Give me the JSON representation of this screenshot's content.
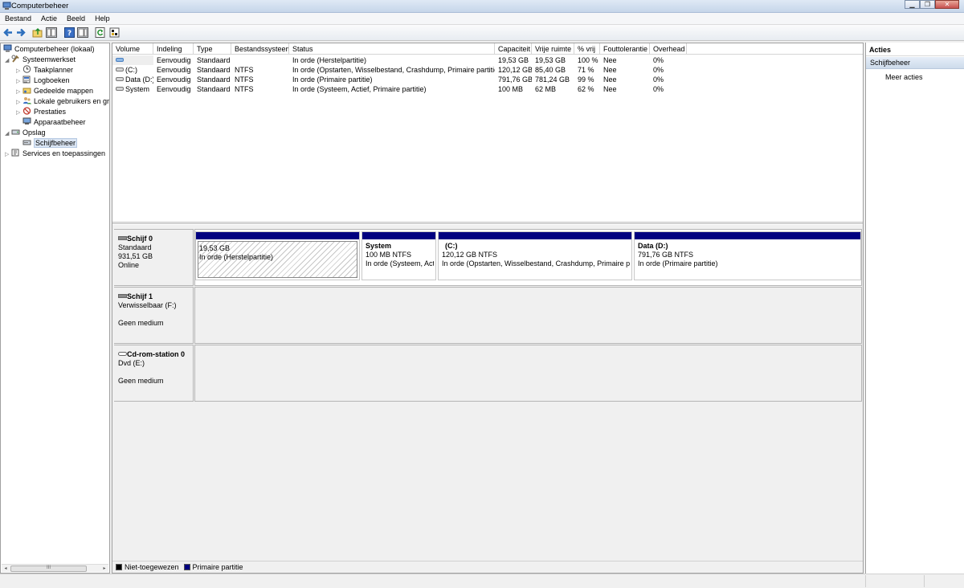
{
  "window": {
    "title": "Computerbeheer",
    "buttons": [
      "minimize",
      "restore",
      "close"
    ]
  },
  "menubar": {
    "items": [
      "Bestand",
      "Actie",
      "Beeld",
      "Help"
    ]
  },
  "toolbar": {
    "icons": [
      "back-arrow-icon",
      "forward-arrow-icon",
      "up-folder-icon",
      "show-hide-tree-icon",
      "help-icon",
      "show-hide-action-pane-icon",
      "refresh-icon",
      "properties-icon"
    ]
  },
  "tree": {
    "items": [
      {
        "label": "Computerbeheer (lokaal)",
        "level": 0,
        "expander": "",
        "icon": "computer-management-icon"
      },
      {
        "label": "Systeemwerkset",
        "level": 1,
        "expander": "◢",
        "icon": "tools-icon"
      },
      {
        "label": "Taakplanner",
        "level": 2,
        "expander": "▷",
        "icon": "clock-icon"
      },
      {
        "label": "Logboeken",
        "level": 2,
        "expander": "▷",
        "icon": "event-log-icon"
      },
      {
        "label": "Gedeelde mappen",
        "level": 2,
        "expander": "▷",
        "icon": "shared-folder-icon"
      },
      {
        "label": "Lokale gebruikers en gr",
        "level": 2,
        "expander": "▷",
        "icon": "users-icon"
      },
      {
        "label": "Prestaties",
        "level": 2,
        "expander": "▷",
        "icon": "no-performance-icon"
      },
      {
        "label": "Apparaatbeheer",
        "level": 2,
        "expander": "",
        "icon": "device-manager-icon"
      },
      {
        "label": "Opslag",
        "level": 1,
        "expander": "◢",
        "icon": "storage-icon"
      },
      {
        "label": "Schijfbeheer",
        "level": 2,
        "expander": "",
        "icon": "disk-management-icon",
        "selected": true
      },
      {
        "label": "Services en toepassingen",
        "level": 1,
        "expander": "▷",
        "icon": "services-icon"
      }
    ],
    "hscroll": {
      "left_arrow": "◂",
      "right_arrow": "▸",
      "grip": "III"
    }
  },
  "volumes": {
    "columns": [
      "Volume",
      "Indeling",
      "Type",
      "Bestandssysteem",
      "Status",
      "Capaciteit",
      "Vrije ruimte",
      "% vrij",
      "Fouttolerantie",
      "Overhead"
    ],
    "rows": [
      [
        "",
        "Eenvoudig",
        "Standaard",
        "",
        "In orde (Herstelpartitie)",
        "19,53 GB",
        "19,53 GB",
        "100 %",
        "Nee",
        "0%"
      ],
      [
        "(C:)",
        "Eenvoudig",
        "Standaard",
        "NTFS",
        "In orde (Opstarten, Wisselbestand, Crashdump, Primaire partitie)",
        "120,12 GB",
        "85,40 GB",
        "71 %",
        "Nee",
        "0%"
      ],
      [
        "Data (D:)",
        "Eenvoudig",
        "Standaard",
        "NTFS",
        "In orde (Primaire partitie)",
        "791,76 GB",
        "781,24 GB",
        "99 %",
        "Nee",
        "0%"
      ],
      [
        "System",
        "Eenvoudig",
        "Standaard",
        "NTFS",
        "In orde (Systeem, Actief, Primaire partitie)",
        "100 MB",
        "62 MB",
        "62 %",
        "Nee",
        "0%"
      ]
    ]
  },
  "disks": [
    {
      "name": "Schijf 0",
      "line1": "Standaard",
      "line2": "931,51 GB",
      "line3": "Online",
      "partitions": [
        {
          "title": "",
          "size": "19,53 GB",
          "status": "In orde (Herstelpartitie)",
          "hatched": true
        },
        {
          "title": "System",
          "size": "100 MB NTFS",
          "status": "In orde (Systeem, Acti",
          "hatched": false
        },
        {
          "title": "(C:)",
          "size": "120,12 GB NTFS",
          "status": "In orde (Opstarten, Wisselbestand, Crashdump, Primaire parti",
          "hatched": false
        },
        {
          "title": "Data  (D:)",
          "size": "791,76 GB NTFS",
          "status": "In orde (Primaire partitie)",
          "hatched": false
        }
      ]
    },
    {
      "name": "Schijf 1",
      "line1": "Verwisselbaar (F:)",
      "line2": "",
      "line3": "Geen medium",
      "partitions": []
    },
    {
      "name": "Cd-rom-station 0",
      "line1": "Dvd (E:)",
      "line2": "",
      "line3": "Geen medium",
      "partitions": []
    }
  ],
  "legend": [
    {
      "label": "Niet-toegewezen",
      "color": "#000000"
    },
    {
      "label": "Primaire partitie",
      "color": "#000080"
    }
  ],
  "actions": {
    "header": "Acties",
    "section": "Schijfbeheer",
    "link": "Meer acties"
  },
  "colors": {
    "primary_partition": "#000080",
    "selection": "#dbe6f4"
  }
}
